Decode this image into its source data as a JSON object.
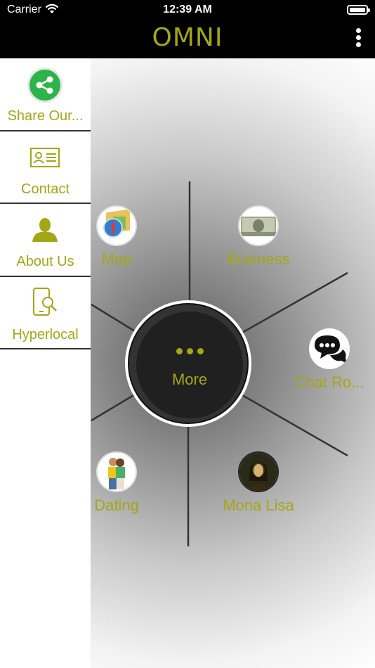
{
  "status_bar": {
    "carrier": "Carrier",
    "time": "12:39 AM"
  },
  "nav": {
    "title": "OMNI"
  },
  "side_menu": {
    "items": [
      {
        "label": "Share Our...",
        "icon": "share-icon"
      },
      {
        "label": "Contact",
        "icon": "contact-card-icon"
      },
      {
        "label": "About Us",
        "icon": "person-icon"
      },
      {
        "label": "Hyperlocal",
        "icon": "phone-search-icon"
      }
    ]
  },
  "radial_menu": {
    "center_label": "More",
    "items": [
      {
        "label": "Map",
        "icon": "map-compass-icon"
      },
      {
        "label": "Business",
        "icon": "money-icon"
      },
      {
        "label": "Chat Ro...",
        "icon": "chat-bubbles-icon"
      },
      {
        "label": "Mona Lisa",
        "icon": "mona-lisa-icon"
      },
      {
        "label": "Dating",
        "icon": "couple-icon"
      }
    ]
  },
  "colors": {
    "accent": "#a3a716",
    "bar": "#000000",
    "share_green": "#2eb34a"
  }
}
